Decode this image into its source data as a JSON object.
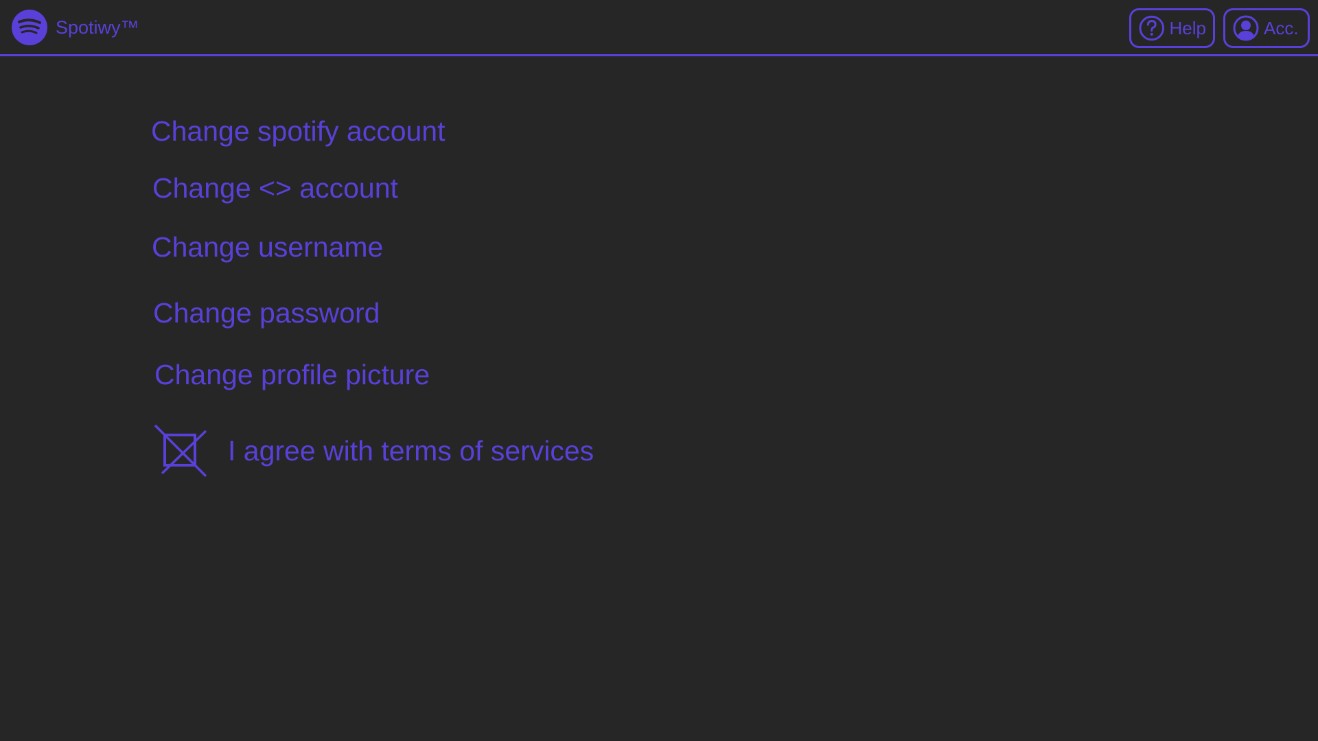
{
  "app": {
    "title": "Spotiwy™",
    "logo_icon": "spotify-logo-icon"
  },
  "header": {
    "help_label": "Help",
    "help_icon": "question-circle-icon",
    "account_label": "Acc.",
    "account_icon": "user-circle-icon"
  },
  "menu": {
    "items": [
      {
        "label": "Change spotify account"
      },
      {
        "label": "Change <> account"
      },
      {
        "label": "Change username"
      },
      {
        "label": "Change password"
      },
      {
        "label": "Change profile picture"
      }
    ]
  },
  "terms": {
    "label": "I agree with terms of services",
    "checkbox_icon": "crossed-checkbox-icon",
    "checked": true
  },
  "colors": {
    "accent": "#5a40d8",
    "background": "#262626"
  }
}
